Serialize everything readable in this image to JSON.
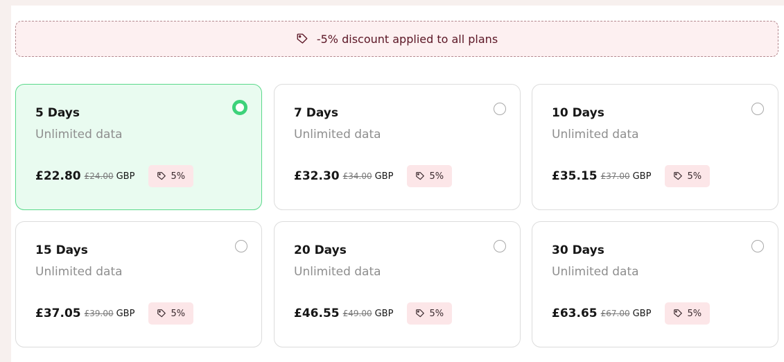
{
  "banner": {
    "text": "-5% discount applied to all plans",
    "icon": "tag-icon"
  },
  "plans": [
    {
      "title": "5 Days",
      "subtitle": "Unlimited data",
      "price": "£22.80",
      "old_price": "£24.00",
      "currency": "GBP",
      "discount": "5%",
      "selected": true
    },
    {
      "title": "7 Days",
      "subtitle": "Unlimited data",
      "price": "£32.30",
      "old_price": "£34.00",
      "currency": "GBP",
      "discount": "5%",
      "selected": false
    },
    {
      "title": "10 Days",
      "subtitle": "Unlimited data",
      "price": "£35.15",
      "old_price": "£37.00",
      "currency": "GBP",
      "discount": "5%",
      "selected": false
    },
    {
      "title": "15 Days",
      "subtitle": "Unlimited data",
      "price": "£37.05",
      "old_price": "£39.00",
      "currency": "GBP",
      "discount": "5%",
      "selected": false
    },
    {
      "title": "20 Days",
      "subtitle": "Unlimited data",
      "price": "£46.55",
      "old_price": "£49.00",
      "currency": "GBP",
      "discount": "5%",
      "selected": false
    },
    {
      "title": "30 Days",
      "subtitle": "Unlimited data",
      "price": "£63.65",
      "old_price": "£67.00",
      "currency": "GBP",
      "discount": "5%",
      "selected": false
    }
  ],
  "colors": {
    "accent_green": "#3dd27a",
    "selected_bg": "#e9fbf0",
    "badge_bg": "#fce6e8",
    "banner_text": "#5a1524"
  }
}
